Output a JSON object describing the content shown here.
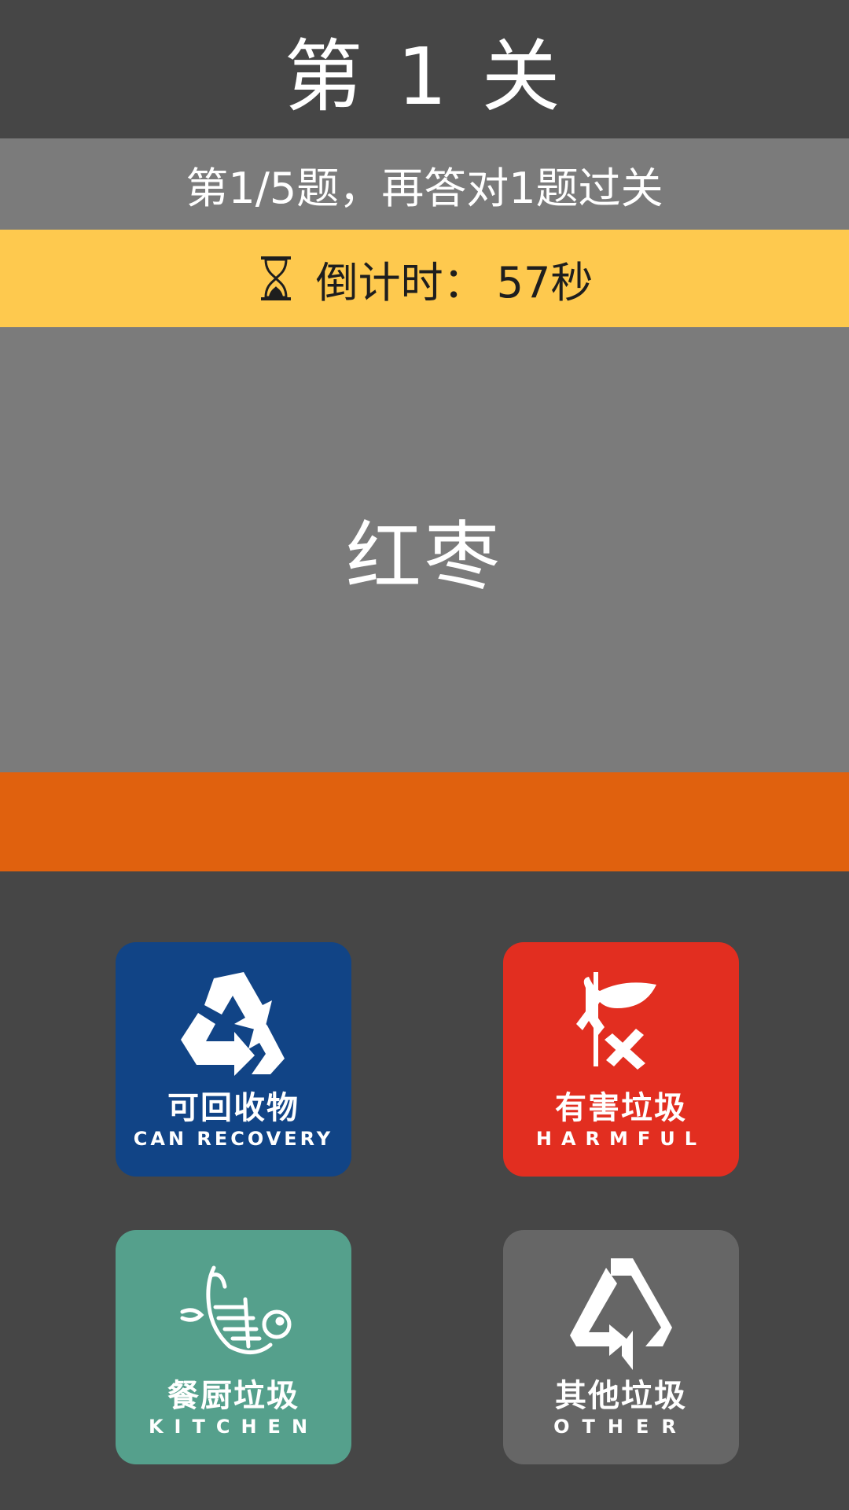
{
  "level": {
    "title": "第 1 关"
  },
  "progress": {
    "text": "第1/5题，再答对1题过关"
  },
  "timer": {
    "icon": "hourglass-icon",
    "label": "倒计时：",
    "value": "57秒"
  },
  "question": {
    "word": "红枣"
  },
  "colors": {
    "background": "#464646",
    "panel": "#7b7b7b",
    "timer_bar": "#fec94e",
    "feedback_strip": "#e0610e"
  },
  "bins": [
    {
      "id": "recyclable",
      "label_cn": "可回收物",
      "label_en": "CAN RECOVERY",
      "color": "#114486",
      "icon": "recycle-icon"
    },
    {
      "id": "harmful",
      "label_cn": "有害垃圾",
      "label_en": "HARMFUL",
      "color": "#e22e20",
      "icon": "hazard-icon"
    },
    {
      "id": "kitchen",
      "label_cn": "餐厨垃圾",
      "label_en": "KITCHEN",
      "color": "#55a08c",
      "icon": "food-waste-icon"
    },
    {
      "id": "other",
      "label_cn": "其他垃圾",
      "label_en": "OTHER",
      "color": "#666666",
      "icon": "other-waste-icon"
    }
  ]
}
